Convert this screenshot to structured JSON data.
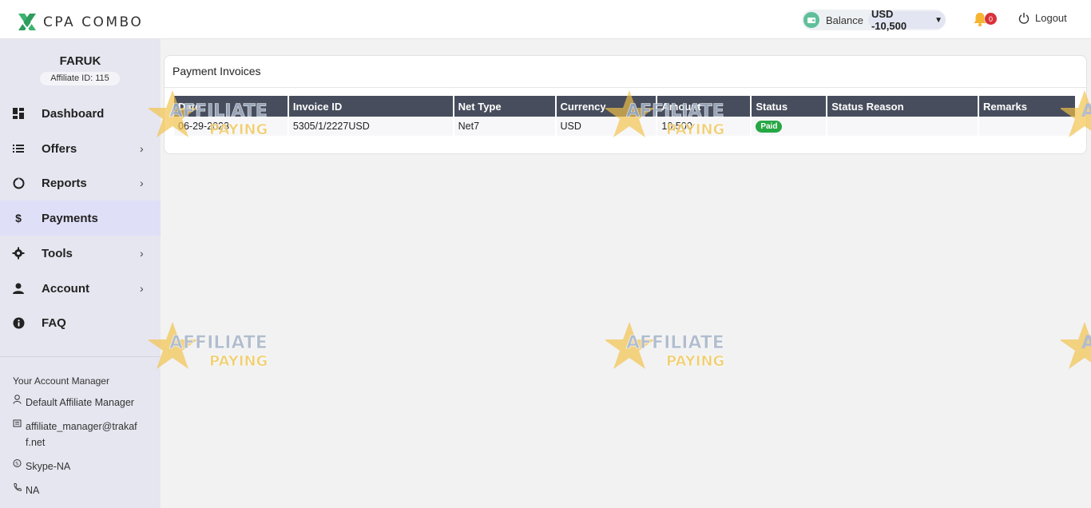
{
  "header": {
    "brand": "CPA COMBO",
    "balance_label": "Balance",
    "balance_value": "USD -10,500",
    "notifications_count": "0",
    "logout_label": "Logout"
  },
  "sidebar": {
    "user_name": "FARUK",
    "affiliate_id": "Affiliate ID: 115",
    "items": [
      {
        "label": "Dashboard",
        "icon": "dashboard-icon",
        "has_submenu": false
      },
      {
        "label": "Offers",
        "icon": "list-icon",
        "has_submenu": true
      },
      {
        "label": "Reports",
        "icon": "pie-icon",
        "has_submenu": true
      },
      {
        "label": "Payments",
        "icon": "dollar-icon",
        "has_submenu": false,
        "active": true
      },
      {
        "label": "Tools",
        "icon": "gear-icon",
        "has_submenu": true
      },
      {
        "label": "Account",
        "icon": "user-icon",
        "has_submenu": true
      },
      {
        "label": "FAQ",
        "icon": "info-icon",
        "has_submenu": false
      }
    ],
    "account_manager": {
      "title": "Your Account Manager",
      "name": "Default Affiliate Manager",
      "email_line1": "affiliate_manager@trakaf",
      "email_line2": "f.net",
      "skype": "Skype-NA",
      "phone": "NA"
    }
  },
  "main": {
    "title": "Payment Invoices",
    "columns": [
      "Date",
      "Invoice ID",
      "Net Type",
      "Currency",
      "Amount",
      "Status",
      "Status Reason",
      "Remarks"
    ],
    "rows": [
      {
        "date": "06-29-2023",
        "invoice_id": "5305/1/2227USD",
        "net_type": "Net7",
        "currency": "USD",
        "amount": "10,500",
        "status": "Paid",
        "status_reason": "",
        "remarks": ""
      }
    ]
  },
  "watermark": {
    "line1": "AFFILIATE",
    "line2": "PAYING"
  },
  "colors": {
    "accent_green": "#3cb371",
    "table_header": "#474d5c",
    "paid_badge": "#28a745",
    "sidebar_bg": "#e6e6f0",
    "active_item": "#e0dff8"
  }
}
